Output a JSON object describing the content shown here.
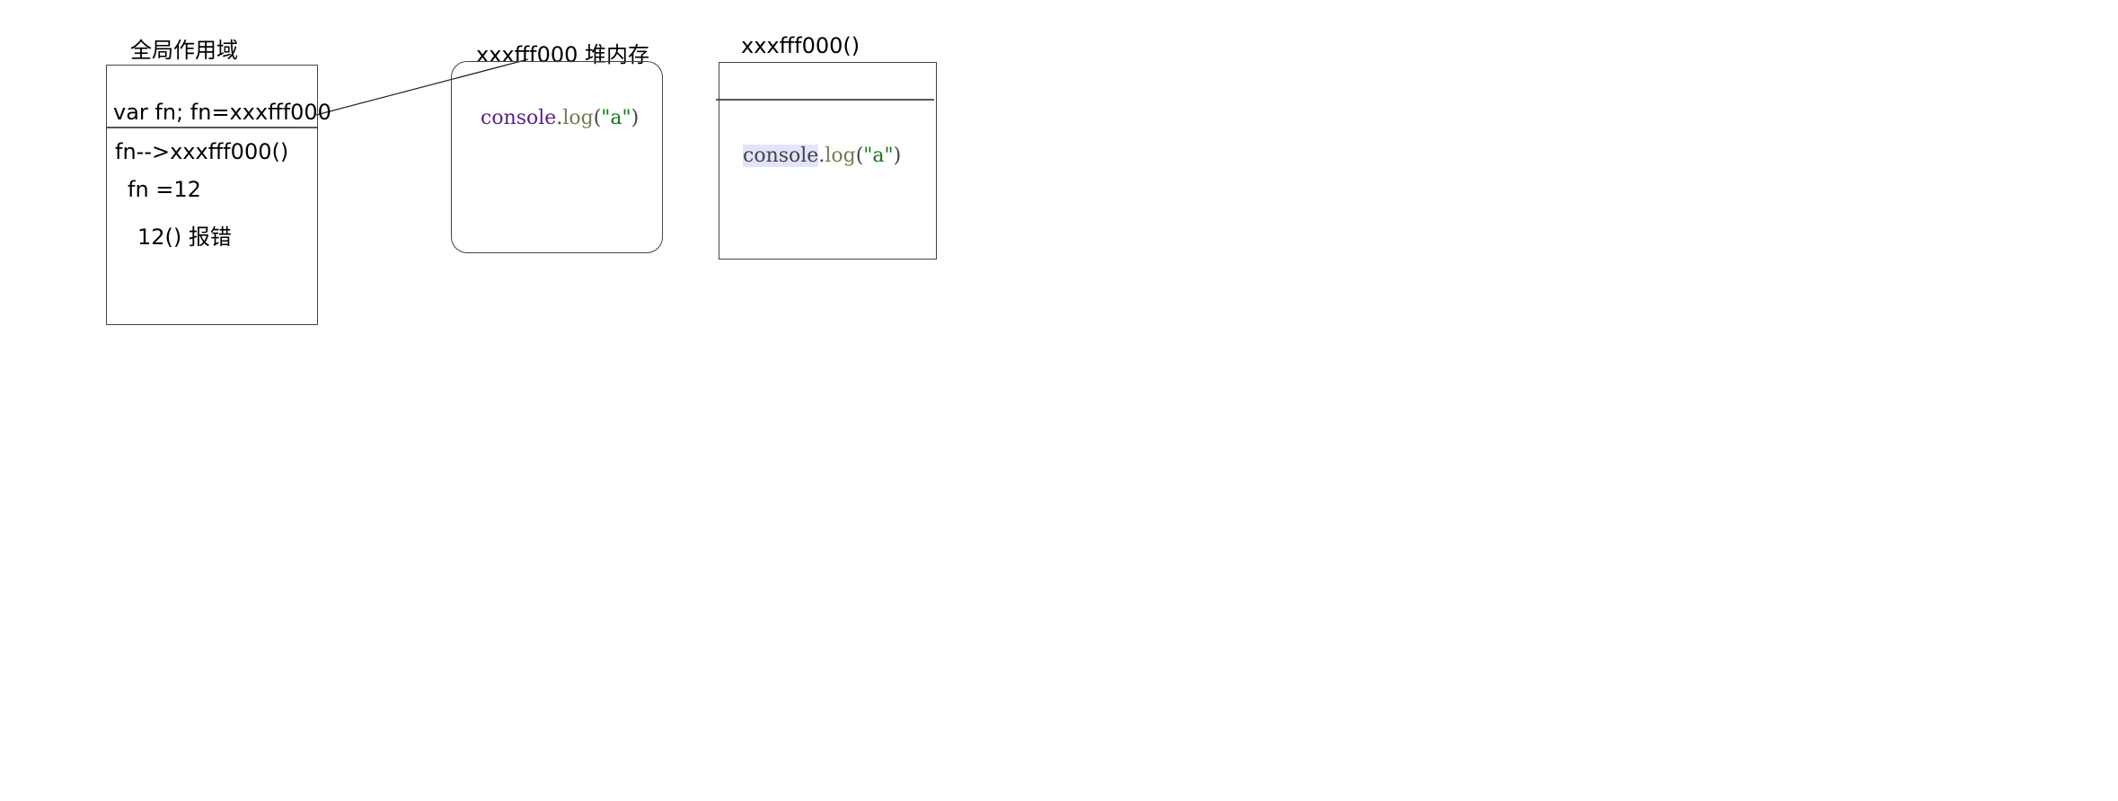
{
  "global_scope": {
    "title": "全局作用域",
    "line1": "var fn;  fn=xxxfff000",
    "line2": "fn-->xxxfff000()",
    "line3": "fn =12",
    "line4": "12()  报错"
  },
  "heap": {
    "title": "xxxfff000  堆内存",
    "code": {
      "obj": "console",
      "dot": ".",
      "method": "log",
      "open": "(",
      "str": "\"a\"",
      "close": ")"
    }
  },
  "exec": {
    "title": "xxxfff000()",
    "code": {
      "obj": "console",
      "dot": ".",
      "method": "log",
      "open": "(",
      "str": "\"a\"",
      "close": ")"
    }
  }
}
